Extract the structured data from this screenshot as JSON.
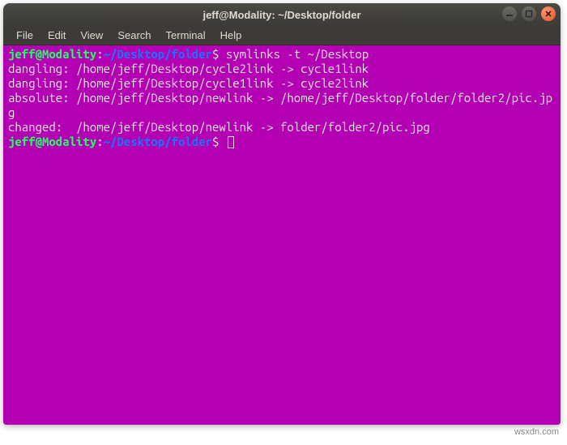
{
  "window": {
    "title": "jeff@Modality: ~/Desktop/folder"
  },
  "menubar": {
    "items": [
      "File",
      "Edit",
      "View",
      "Search",
      "Terminal",
      "Help"
    ]
  },
  "prompt": {
    "user_host": "jeff@Modality",
    "sep1": ":",
    "path": "~/Desktop/folder",
    "sep2": "$"
  },
  "terminal": {
    "command": "symlinks -t ~/Desktop",
    "output_lines": [
      "dangling: /home/jeff/Desktop/cycle2link -> cycle1link",
      "dangling: /home/jeff/Desktop/cycle1link -> cycle2link",
      "absolute: /home/jeff/Desktop/newlink -> /home/jeff/Desktop/folder/folder2/pic.jpg",
      "changed:  /home/jeff/Desktop/newlink -> folder/folder2/pic.jpg"
    ]
  },
  "watermark": "wsxdn.com"
}
